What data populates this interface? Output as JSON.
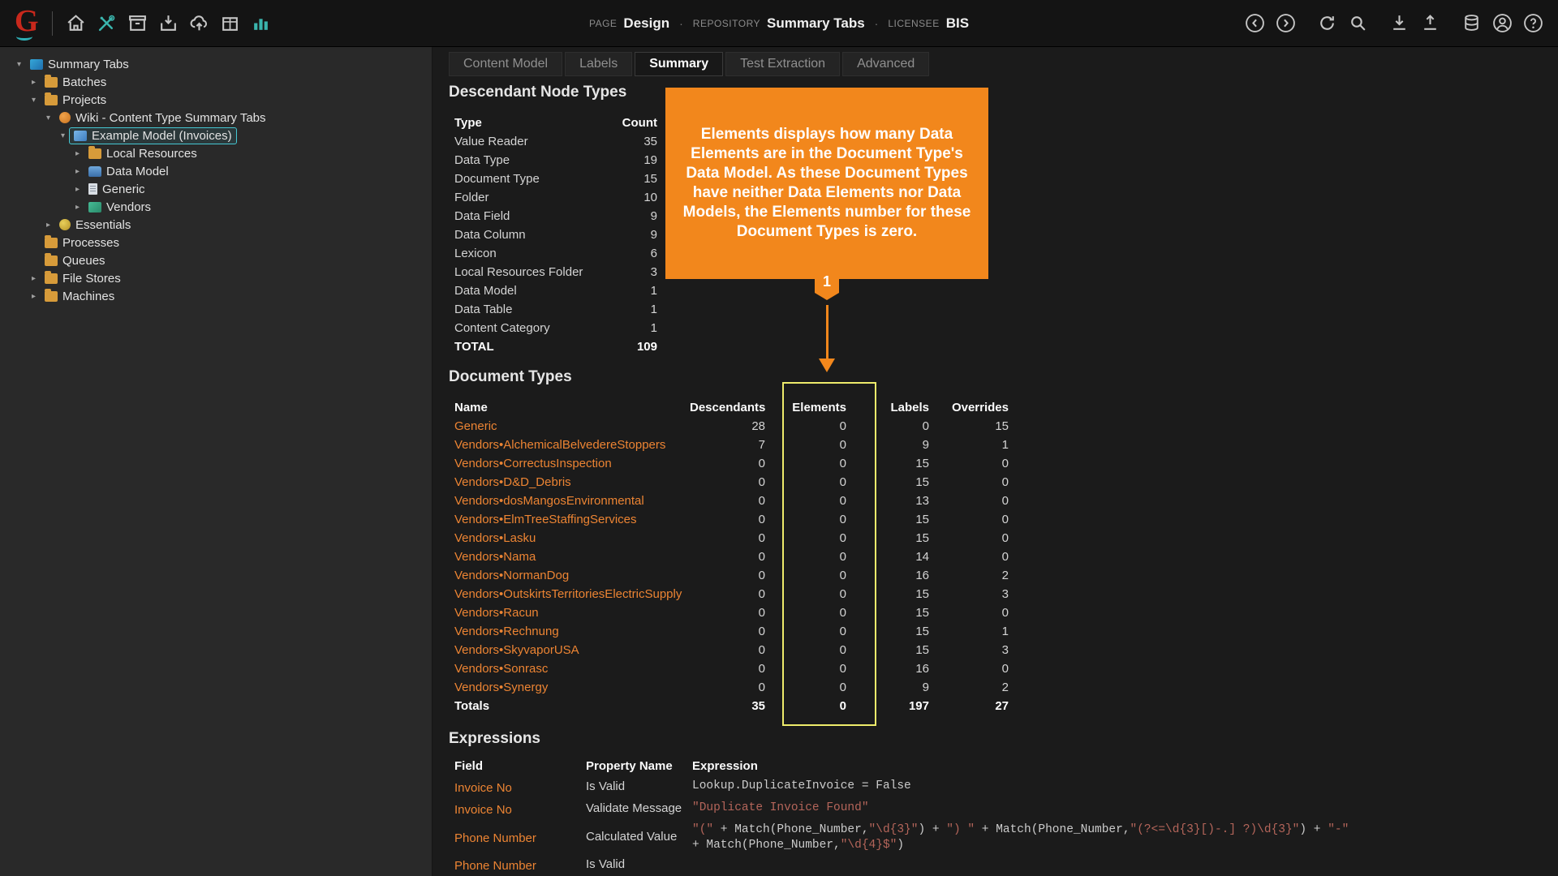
{
  "colors": {
    "accent_orange": "#f2871c",
    "link_orange": "#ec8433",
    "highlight_yellow": "#eeeb6b",
    "selection_teal": "#45c8d4"
  },
  "topbar": {
    "logo": "G",
    "left_icons": [
      "home",
      "tools",
      "batches-box",
      "import-box",
      "cloud-upload",
      "package",
      "stats-chart"
    ],
    "breadcrumb": [
      {
        "label": "PAGE",
        "value": "Design"
      },
      {
        "label": "REPOSITORY",
        "value": "Summary Tabs"
      },
      {
        "label": "LICENSEE",
        "value": "BIS"
      }
    ],
    "separator": "·",
    "right_icon_groups": [
      [
        "back",
        "forward"
      ],
      [
        "refresh",
        "search"
      ],
      [
        "download",
        "upload"
      ],
      [
        "database",
        "user",
        "help"
      ]
    ]
  },
  "sidebar": {
    "items": [
      {
        "label": "Summary Tabs",
        "level": 0,
        "arrow": "expanded",
        "icon": "tabs"
      },
      {
        "label": "Batches",
        "level": 1,
        "arrow": "collapsed",
        "icon": "folder"
      },
      {
        "label": "Projects",
        "level": 1,
        "arrow": "expanded",
        "icon": "folder"
      },
      {
        "label": "Wiki - Content Type Summary Tabs",
        "level": 2,
        "arrow": "expanded",
        "icon": "wiki"
      },
      {
        "label": "Example Model (Invoices)",
        "level": 3,
        "arrow": "expanded",
        "icon": "content-model",
        "selected": true
      },
      {
        "label": "Local Resources",
        "level": 4,
        "arrow": "collapsed",
        "icon": "folder"
      },
      {
        "label": "Data Model",
        "level": 4,
        "arrow": "collapsed",
        "icon": "data-model"
      },
      {
        "label": "Generic",
        "level": 4,
        "arrow": "collapsed",
        "icon": "document"
      },
      {
        "label": "Vendors",
        "level": 4,
        "arrow": "collapsed",
        "icon": "hierarchy"
      },
      {
        "label": "Essentials",
        "level": 2,
        "arrow": "collapsed",
        "icon": "essentials"
      },
      {
        "label": "Processes",
        "level": 1,
        "arrow": "none",
        "icon": "folder"
      },
      {
        "label": "Queues",
        "level": 1,
        "arrow": "none",
        "icon": "folder"
      },
      {
        "label": "File Stores",
        "level": 1,
        "arrow": "collapsed",
        "icon": "folder"
      },
      {
        "label": "Machines",
        "level": 1,
        "arrow": "collapsed",
        "icon": "folder"
      }
    ]
  },
  "main": {
    "tabs": [
      {
        "label": "Content Model",
        "active": false
      },
      {
        "label": "Labels",
        "active": false
      },
      {
        "label": "Summary",
        "active": true
      },
      {
        "label": "Test Extraction",
        "active": false
      },
      {
        "label": "Advanced",
        "active": false
      }
    ]
  },
  "descendant_node_types": {
    "title": "Descendant Node Types",
    "headers": [
      "Type",
      "Count"
    ],
    "rows": [
      {
        "type": "Value Reader",
        "count": 35
      },
      {
        "type": "Data Type",
        "count": 19
      },
      {
        "type": "Document Type",
        "count": 15
      },
      {
        "type": "Folder",
        "count": 10
      },
      {
        "type": "Data Field",
        "count": 9
      },
      {
        "type": "Data Column",
        "count": 9
      },
      {
        "type": "Lexicon",
        "count": 6
      },
      {
        "type": "Local Resources Folder",
        "count": 3
      },
      {
        "type": "Data Model",
        "count": 1
      },
      {
        "type": "Data Table",
        "count": 1
      },
      {
        "type": "Content Category",
        "count": 1
      },
      {
        "type": "TOTAL",
        "count": 109,
        "bold": true
      }
    ]
  },
  "callout": {
    "text": "Elements displays how many Data Elements are in the Document Type's Data Model. As these Document Types have neither Data Elements nor Data Models, the Elements number for these Document Types is zero.",
    "marker": "1"
  },
  "document_types": {
    "title": "Document Types",
    "headers": [
      "Name",
      "Descendants",
      "Elements",
      "Labels",
      "Overrides"
    ],
    "rows": [
      {
        "name": "Generic",
        "descendants": 28,
        "elements": 0,
        "labels": 0,
        "overrides": 15
      },
      {
        "name": "Vendors•AlchemicalBelvedereStoppers",
        "descendants": 7,
        "elements": 0,
        "labels": 9,
        "overrides": 1
      },
      {
        "name": "Vendors•CorrectusInspection",
        "descendants": 0,
        "elements": 0,
        "labels": 15,
        "overrides": 0
      },
      {
        "name": "Vendors•D&D_Debris",
        "descendants": 0,
        "elements": 0,
        "labels": 15,
        "overrides": 0
      },
      {
        "name": "Vendors•dosMangosEnvironmental",
        "descendants": 0,
        "elements": 0,
        "labels": 13,
        "overrides": 0
      },
      {
        "name": "Vendors•ElmTreeStaffingServices",
        "descendants": 0,
        "elements": 0,
        "labels": 15,
        "overrides": 0
      },
      {
        "name": "Vendors•Lasku",
        "descendants": 0,
        "elements": 0,
        "labels": 15,
        "overrides": 0
      },
      {
        "name": "Vendors•Nama",
        "descendants": 0,
        "elements": 0,
        "labels": 14,
        "overrides": 0
      },
      {
        "name": "Vendors•NormanDog",
        "descendants": 0,
        "elements": 0,
        "labels": 16,
        "overrides": 2
      },
      {
        "name": "Vendors•OutskirtsTerritoriesElectricSupply",
        "descendants": 0,
        "elements": 0,
        "labels": 15,
        "overrides": 3
      },
      {
        "name": "Vendors•Racun",
        "descendants": 0,
        "elements": 0,
        "labels": 15,
        "overrides": 0
      },
      {
        "name": "Vendors•Rechnung",
        "descendants": 0,
        "elements": 0,
        "labels": 15,
        "overrides": 1
      },
      {
        "name": "Vendors•SkyvaporUSA",
        "descendants": 0,
        "elements": 0,
        "labels": 15,
        "overrides": 3
      },
      {
        "name": "Vendors•Sonrasc",
        "descendants": 0,
        "elements": 0,
        "labels": 16,
        "overrides": 0
      },
      {
        "name": "Vendors•Synergy",
        "descendants": 0,
        "elements": 0,
        "labels": 9,
        "overrides": 2
      },
      {
        "name": "Totals",
        "descendants": 35,
        "elements": 0,
        "labels": 197,
        "overrides": 27,
        "bold": true
      }
    ]
  },
  "expressions": {
    "title": "Expressions",
    "headers": [
      "Field",
      "Property Name",
      "Expression"
    ],
    "rows": [
      {
        "field": "Invoice No",
        "property": "Is Valid",
        "expression": "Lookup.DuplicateInvoice = False"
      },
      {
        "field": "Invoice No",
        "property": "Validate Message",
        "expression": "\"Duplicate Invoice Found\""
      },
      {
        "field": "Phone Number",
        "property": "Calculated Value",
        "expression": "\"(\" + Match(Phone_Number,\"\\d{3}\") + \") \" + Match(Phone_Number,\"(?<=\\d{3}[)-.] ?)\\d{3}\") + \"-\" + Match(Phone_Number,\"\\d{4}$\")"
      },
      {
        "field": "Phone Number",
        "property": "Is Valid",
        "expression": ""
      }
    ]
  }
}
